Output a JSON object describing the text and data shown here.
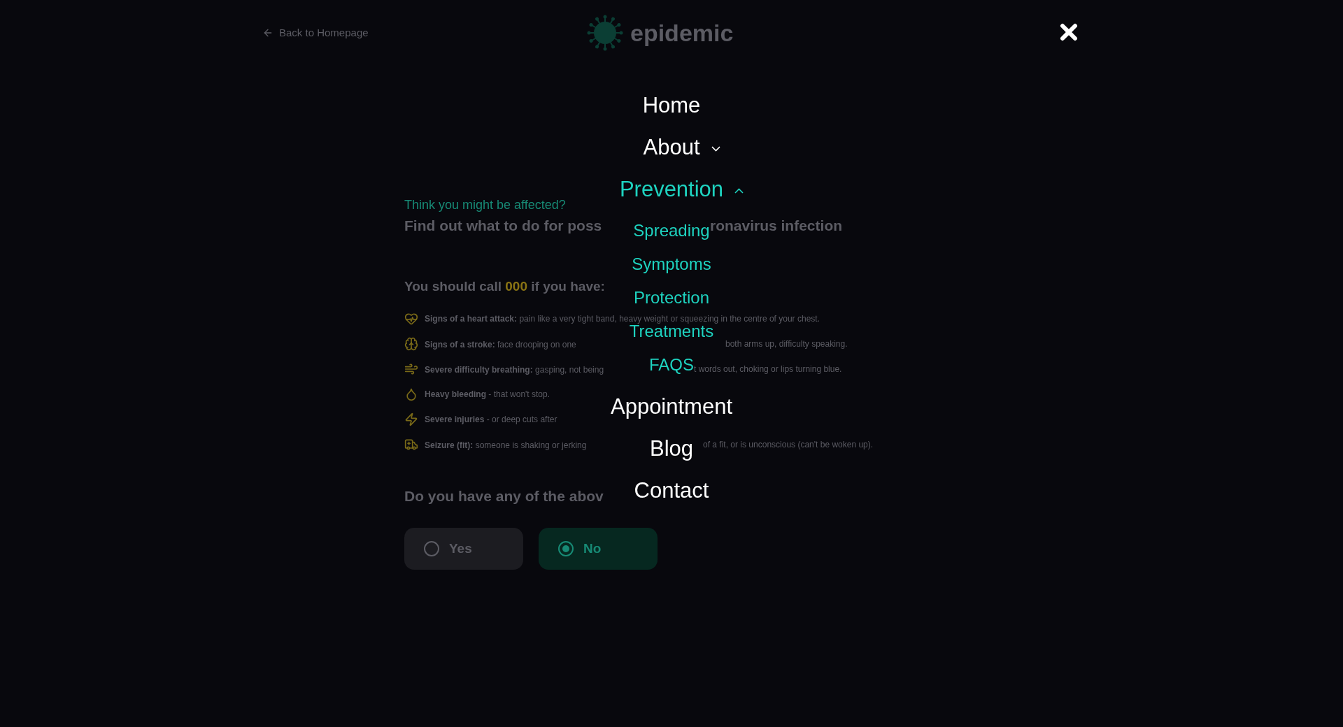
{
  "page": {
    "back_link": "Back to Homepage",
    "logo_text": "epidemic",
    "kicker": "Think you might be affected?",
    "heading": [
      "Find out what to do for poss",
      "ronavirus infection"
    ],
    "call_prefix": "You should call",
    "call_number": "000",
    "call_suffix": "if you have:",
    "symptoms": [
      {
        "kind": "heart",
        "segments": [
          "**Signs of a heart attack:** pain like a very tight band, heavy weight or squeezing in the centre of your chest."
        ]
      },
      {
        "kind": "brain",
        "segments": [
          "**Signs of a stroke:** face drooping on one",
          "both arms up, difficulty speaking."
        ]
      },
      {
        "kind": "breath",
        "segments": [
          "**Severe difficulty breathing:** gasping, not being",
          "t words out, choking or lips turning blue."
        ]
      },
      {
        "kind": "blood",
        "segments": [
          "**Heavy bleeding** - that won't stop."
        ]
      },
      {
        "kind": "injury",
        "segments": [
          "**Severe injuries** - or deep cuts after"
        ]
      },
      {
        "kind": "seizure",
        "segments": [
          "**Seizure (fit):** someone is shaking or jerking",
          "of a fit, or is unconscious (can't be woken up)."
        ]
      }
    ],
    "question": "Do you have any of the abov",
    "options": [
      {
        "label": "Yes",
        "selected": false
      },
      {
        "label": "No",
        "selected": true
      }
    ]
  },
  "menu": {
    "items": [
      {
        "label": "Home"
      },
      {
        "label": "About",
        "expanded": false
      },
      {
        "label": "Prevention",
        "expanded": true,
        "children": [
          {
            "label": "Spreading"
          },
          {
            "label": "Symptoms"
          },
          {
            "label": "Protection"
          },
          {
            "label": "Treatments"
          },
          {
            "label": "FAQS"
          }
        ]
      },
      {
        "label": "Appointment"
      },
      {
        "label": "Blog"
      },
      {
        "label": "Contact"
      }
    ]
  }
}
